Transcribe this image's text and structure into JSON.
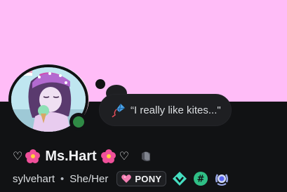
{
  "colors": {
    "banner": "#ffbcf7",
    "background": "#111214",
    "status_online": "#2f8a45",
    "bubble_bg": "#1e1f22"
  },
  "profile": {
    "display_name": "Ms.Hart",
    "username": "sylvehart",
    "pronouns": "She/Her",
    "separator": "•",
    "status_text": "“I really like kites...\"",
    "status_emoji": "kite-icon",
    "name_decorations": [
      "heart-outline-icon",
      "hibiscus-icon",
      "hibiscus-icon",
      "heart-outline-icon"
    ],
    "tag_label": "PONY",
    "tag_icon": "heart-icon",
    "badges": [
      "hypesquad-balance-icon",
      "hashtag-icon",
      "laurel-badge-icon"
    ],
    "nitro_icon": "nitro-icon",
    "online_status": "online"
  }
}
